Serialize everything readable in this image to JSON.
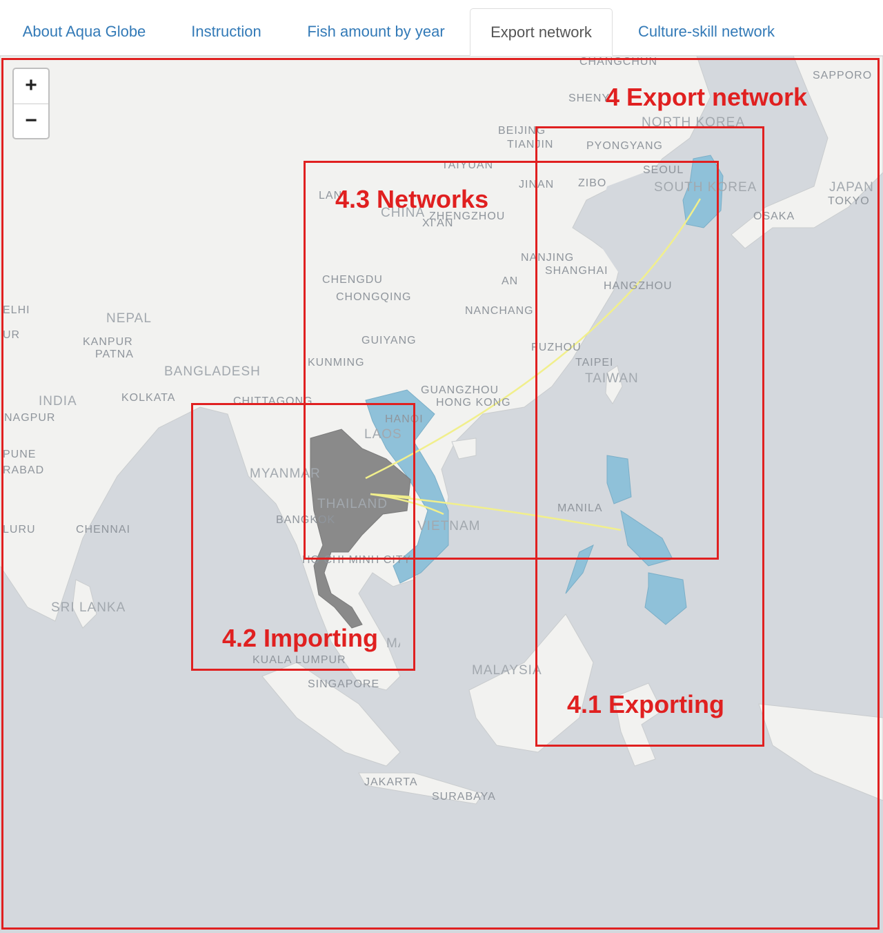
{
  "tabs": [
    {
      "label": "About Aqua Globe",
      "active": false
    },
    {
      "label": "Instruction",
      "active": false
    },
    {
      "label": "Fish amount by year",
      "active": false
    },
    {
      "label": "Export network",
      "active": true
    },
    {
      "label": "Culture-skill network",
      "active": false
    }
  ],
  "zoom": {
    "in": "+",
    "out": "−"
  },
  "map": {
    "colors": {
      "sea": "#d4d8dd",
      "land": "#f2f2f0",
      "focus_country": "#8a8a8a",
      "partner_country": "#8fc1d9",
      "link": "#f1ef8c"
    },
    "focus_country": "Thailand",
    "partner_countries": [
      "South Korea",
      "Vietnam",
      "Philippines"
    ],
    "labels": {
      "changchun": "CHANGCHUN",
      "sapporo": "SAPPORO",
      "shenyang": "SHENY",
      "north_korea": "NORTH KOREA",
      "beijing": "BEIJING",
      "tianjin": "TIANJIN",
      "pyongyang": "PYONGYANG",
      "taiyuan": "TAIYUAN",
      "seoul": "SEOUL",
      "south_korea": "SOUTH KOREA",
      "jinan": "JINAN",
      "zibo": "ZIBO",
      "japan": "JAPAN",
      "tokyo": "TOKYO",
      "osaka": "OSAKA",
      "lanzhou": "LAN",
      "china": "CHINA",
      "zhengzhou": "ZHENGZHOU",
      "xian": "XI'AN",
      "nanjing": "NANJING",
      "shanghai": "SHANGHAI",
      "hangzhou": "HANGZHOU",
      "chengdu": "CHENGDU",
      "chongqing": "CHONGQING",
      "hefei": "AN",
      "nanchang": "NANCHANG",
      "delhi": "ELHI",
      "jaipur": "UR",
      "nepal": "NEPAL",
      "kanpur": "KANPUR",
      "patna": "PATNA",
      "guiyang": "GUIYANG",
      "fuzhou": "FUZHOU",
      "taipei": "TAIPEI",
      "taiwan": "TAIWAN",
      "kunming": "KUNMING",
      "bangladesh": "BANGLADESH",
      "india": "INDIA",
      "kolkata": "KOLKATA",
      "chittagong": "CHITTAGONG",
      "guangzhou": "GUANGZHOU",
      "hong_kong": "HONG KONG",
      "nagpur": "NAGPUR",
      "hanoi": "HANOI",
      "laos": "LAOS",
      "pune": "PUNE",
      "hyderabad": "RABAD",
      "myanmar": "MYANMAR",
      "thailand": "THAILAND",
      "manila": "MANILA",
      "bangkok": "BANGKOK",
      "vietnam": "VIETNAM",
      "bengaluru": "LURU",
      "chennai": "CHENNAI",
      "hcmc": "HO CHI MINH CITY",
      "sri_lanka": "SRI LANKA",
      "malaysia_w": "MALAYSIA",
      "kuala_lumpur": "KUALA LUMPUR",
      "malaysia": "MALAYSIA",
      "singapore": "SINGAPORE",
      "jakarta": "JAKARTA",
      "surabaya": "SURABAYA"
    }
  },
  "annotations": {
    "export_network": "4 Export network",
    "networks": "4.3 Networks",
    "importing": "4.2 Importing",
    "exporting": "4.1 Exporting"
  }
}
